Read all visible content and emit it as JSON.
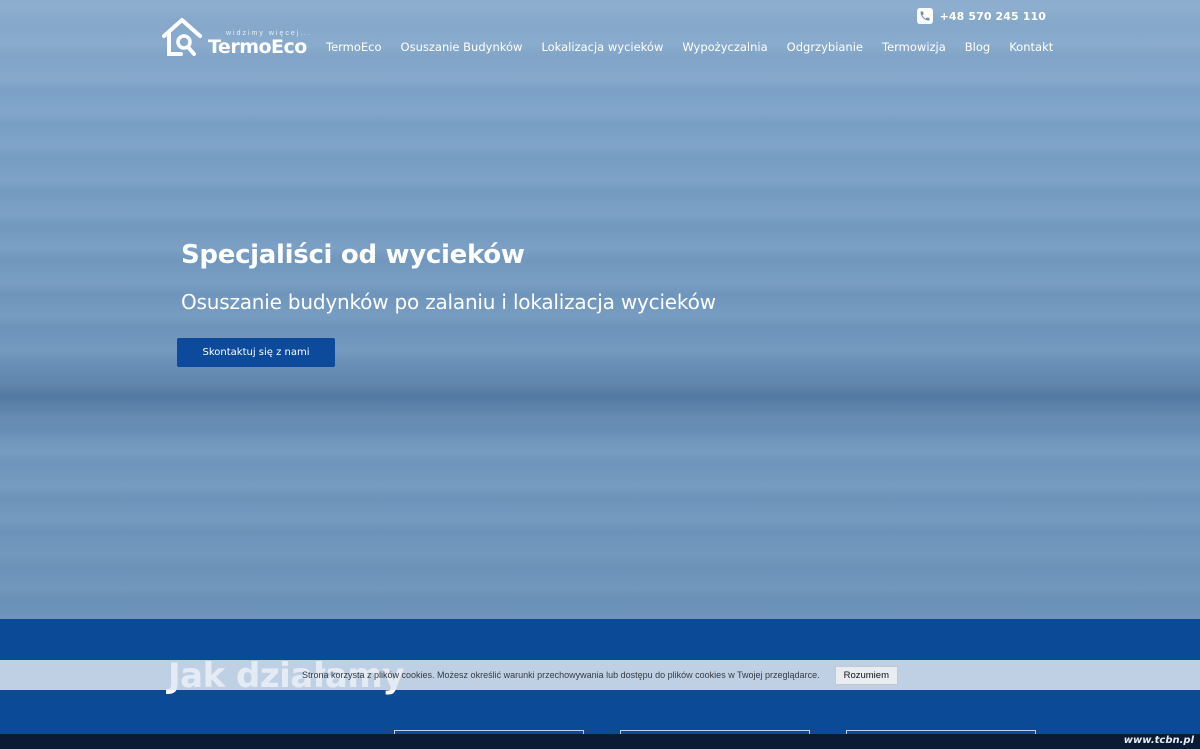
{
  "header": {
    "phone": "+48 570 245 110",
    "logo": {
      "tagline": "widzimy  więcej...",
      "name": "TermoEco"
    },
    "nav": [
      {
        "label": "TermoEco"
      },
      {
        "label": "Osuszanie Budynków"
      },
      {
        "label": "Lokalizacja wycieków"
      },
      {
        "label": "Wypożyczalnia"
      },
      {
        "label": "Odgrzybianie"
      },
      {
        "label": "Termowizja"
      },
      {
        "label": "Blog"
      },
      {
        "label": "Kontakt"
      }
    ]
  },
  "hero": {
    "title": "Specjaliści od wycieków",
    "subtitle": "Osuszanie budynków po zalaniu i lokalizacja wycieków",
    "cta_label": "Skontaktuj się z nami"
  },
  "section_how": {
    "title": "Jak działamy"
  },
  "cookie_bar": {
    "text": "Strona korzysta z plików cookies. Możesz określić warunki przechowywania lub dostępu do plików cookies w Twojej przeglądarce.",
    "button_label": "Rozumiem"
  },
  "watermark": "www.tcbn.pl",
  "colors": {
    "primary_blue": "#0d4a9c",
    "section_blue": "#0b4a96",
    "hero_sky": "#7ea3c7"
  }
}
